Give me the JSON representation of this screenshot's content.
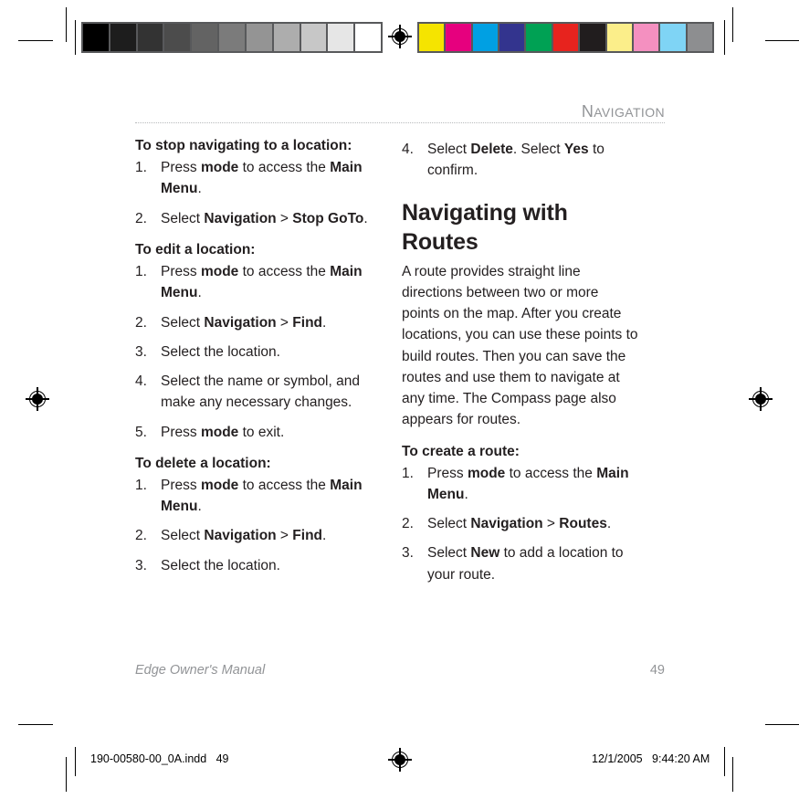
{
  "running_head": {
    "first_letter": "N",
    "rest": "AVIGATION",
    "full": "NAVIGATION"
  },
  "left_column": {
    "blocks": [
      {
        "type": "subhead",
        "text": "To stop navigating to a location:"
      },
      {
        "type": "steps",
        "items": [
          {
            "num": "1.",
            "segments": [
              {
                "text": "Press ",
                "bold": false
              },
              {
                "text": "mode",
                "bold": true
              },
              {
                "text": " to access the ",
                "bold": false
              },
              {
                "text": "Main Menu",
                "bold": true
              },
              {
                "text": ".",
                "bold": false
              }
            ]
          },
          {
            "num": "2.",
            "segments": [
              {
                "text": "Select ",
                "bold": false
              },
              {
                "text": "Navigation",
                "bold": true
              },
              {
                "text": " > ",
                "bold": false
              },
              {
                "text": "Stop GoTo",
                "bold": true
              },
              {
                "text": ".",
                "bold": false
              }
            ]
          }
        ]
      },
      {
        "type": "subhead",
        "text": "To edit a location:"
      },
      {
        "type": "steps",
        "items": [
          {
            "num": "1.",
            "segments": [
              {
                "text": "Press ",
                "bold": false
              },
              {
                "text": "mode",
                "bold": true
              },
              {
                "text": " to access the ",
                "bold": false
              },
              {
                "text": "Main Menu",
                "bold": true
              },
              {
                "text": ".",
                "bold": false
              }
            ]
          },
          {
            "num": "2.",
            "segments": [
              {
                "text": "Select ",
                "bold": false
              },
              {
                "text": "Navigation",
                "bold": true
              },
              {
                "text": " > ",
                "bold": false
              },
              {
                "text": "Find",
                "bold": true
              },
              {
                "text": ".",
                "bold": false
              }
            ]
          },
          {
            "num": "3.",
            "segments": [
              {
                "text": "Select the location.",
                "bold": false
              }
            ]
          },
          {
            "num": "4.",
            "segments": [
              {
                "text": "Select the name or symbol, and make any necessary changes.",
                "bold": false
              }
            ]
          },
          {
            "num": "5.",
            "segments": [
              {
                "text": "Press ",
                "bold": false
              },
              {
                "text": "mode",
                "bold": true
              },
              {
                "text": " to exit.",
                "bold": false
              }
            ]
          }
        ]
      },
      {
        "type": "subhead",
        "text": "To delete a location:"
      },
      {
        "type": "steps",
        "items": [
          {
            "num": "1.",
            "segments": [
              {
                "text": "Press ",
                "bold": false
              },
              {
                "text": "mode",
                "bold": true
              },
              {
                "text": " to access the ",
                "bold": false
              },
              {
                "text": "Main Menu",
                "bold": true
              },
              {
                "text": ".",
                "bold": false
              }
            ]
          },
          {
            "num": "2.",
            "segments": [
              {
                "text": "Select ",
                "bold": false
              },
              {
                "text": "Navigation",
                "bold": true
              },
              {
                "text": " > ",
                "bold": false
              },
              {
                "text": "Find",
                "bold": true
              },
              {
                "text": ".",
                "bold": false
              }
            ]
          },
          {
            "num": "3.",
            "segments": [
              {
                "text": "Select the location.",
                "bold": false
              }
            ]
          }
        ]
      }
    ]
  },
  "right_column": {
    "blocks": [
      {
        "type": "steps",
        "items": [
          {
            "num": "4.",
            "segments": [
              {
                "text": "Select ",
                "bold": false
              },
              {
                "text": "Delete",
                "bold": true
              },
              {
                "text": ". Select ",
                "bold": false
              },
              {
                "text": "Yes",
                "bold": true
              },
              {
                "text": " to confirm.",
                "bold": false
              }
            ]
          }
        ]
      },
      {
        "type": "section_title",
        "text": "Navigating with Routes"
      },
      {
        "type": "paragraph",
        "text": "A route provides straight line directions between two or more points on the map. After you create locations, you can use these points to build routes. Then you can save the routes and use them to navigate at any time. The Compass page also appears for routes."
      },
      {
        "type": "subhead",
        "text": "To create a route:"
      },
      {
        "type": "steps",
        "items": [
          {
            "num": "1.",
            "segments": [
              {
                "text": "Press ",
                "bold": false
              },
              {
                "text": "mode",
                "bold": true
              },
              {
                "text": " to access the ",
                "bold": false
              },
              {
                "text": "Main Menu",
                "bold": true
              },
              {
                "text": ".",
                "bold": false
              }
            ]
          },
          {
            "num": "2.",
            "segments": [
              {
                "text": "Select ",
                "bold": false
              },
              {
                "text": "Navigation",
                "bold": true
              },
              {
                "text": " > ",
                "bold": false
              },
              {
                "text": "Routes",
                "bold": true
              },
              {
                "text": ".",
                "bold": false
              }
            ]
          },
          {
            "num": "3.",
            "segments": [
              {
                "text": "Select ",
                "bold": false
              },
              {
                "text": "New",
                "bold": true
              },
              {
                "text": " to add a location to your route.",
                "bold": false
              }
            ]
          }
        ]
      }
    ]
  },
  "footer": {
    "manual_title": "Edge Owner's Manual",
    "page_number": "49"
  },
  "slug": {
    "filename": "190-00580-00_0A.indd   49",
    "timestamp": "12/1/2005   9:44:20 AM"
  },
  "calibration": {
    "grayscale_patches": [
      "#000000",
      "#1d1d1d",
      "#333333",
      "#4c4c4c",
      "#636363",
      "#7b7b7b",
      "#949494",
      "#adadad",
      "#c7c7c7",
      "#e6e6e6",
      "#ffffff"
    ],
    "color_patches": [
      "#f5e400",
      "#e6007e",
      "#00a0e3",
      "#33348e",
      "#00a154",
      "#e7231e",
      "#211d1e",
      "#fbee8a",
      "#f490c0",
      "#7fd4f5",
      "#8d8e90"
    ],
    "bar_frame_color": "#58595b"
  },
  "marks": {
    "registration_target": "registration-target-icon",
    "crop_mark": "crop-mark"
  }
}
